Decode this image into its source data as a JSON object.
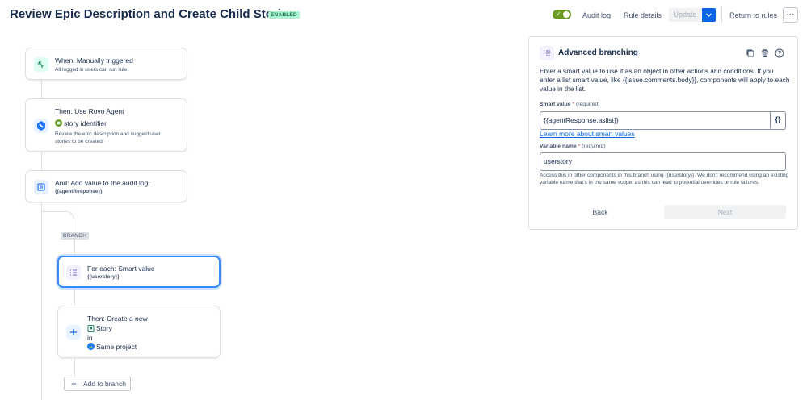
{
  "header": {
    "title": "Review Epic Description and Create Child Stories",
    "status_badge": "ENABLED",
    "audit_log": "Audit log",
    "rule_details": "Rule details",
    "update": "Update",
    "return_to_rules": "Return to rules",
    "more": "···"
  },
  "flow": {
    "trigger": {
      "title": "When: Manually triggered",
      "subtitle": "All logged in users can run rule.",
      "icon": "trigger-icon"
    },
    "rovo": {
      "title": "Then: Use Rovo Agent",
      "agent": "story identifier",
      "subtitle_1": "Review the epic description and suggest user",
      "subtitle_2": "stories to be created.",
      "icon": "rovo-agent-icon"
    },
    "audit": {
      "title": "And: Add value to the audit log.",
      "value": "{{agentResponse}}",
      "icon": "audit-log-icon"
    },
    "branch_label": "BRANCH",
    "foreach": {
      "title": "For each: Smart value",
      "value": "{{userstory}}",
      "icon": "list-icon"
    },
    "create": {
      "title": "Then: Create a new",
      "issue_type": "Story",
      "in": "in",
      "project": "Same project",
      "icon": "plus-icon"
    },
    "add_to_branch": "Add to branch"
  },
  "panel": {
    "title": "Advanced branching",
    "description": "Enter a smart value to use it as an object in other actions and conditions. If you enter a list smart value, like {{issue.comments.body}}, components will apply to each value in the list.",
    "smart_value": {
      "label": "Smart value",
      "required_mark": "*",
      "required_text": "(required)",
      "value": "{{agentResponse.aslist}}",
      "button": "{}"
    },
    "learn_more": "Learn more about smart values",
    "variable_name": {
      "label": "Variable name",
      "required_mark": "*",
      "required_text": "(required)",
      "value": "userstory"
    },
    "helper": "Access this in other components in this branch using {{userstory}}. We don't recommend using an existing variable name that's in the same scope, as this can lead to potential overrides or rule failures.",
    "back": "Back",
    "next": "Next"
  },
  "colors": {
    "accent": "#0c66e4",
    "enabled_badge": "#abf5d1",
    "toggle_on": "#6a9a23",
    "selected_border": "#388bff"
  }
}
